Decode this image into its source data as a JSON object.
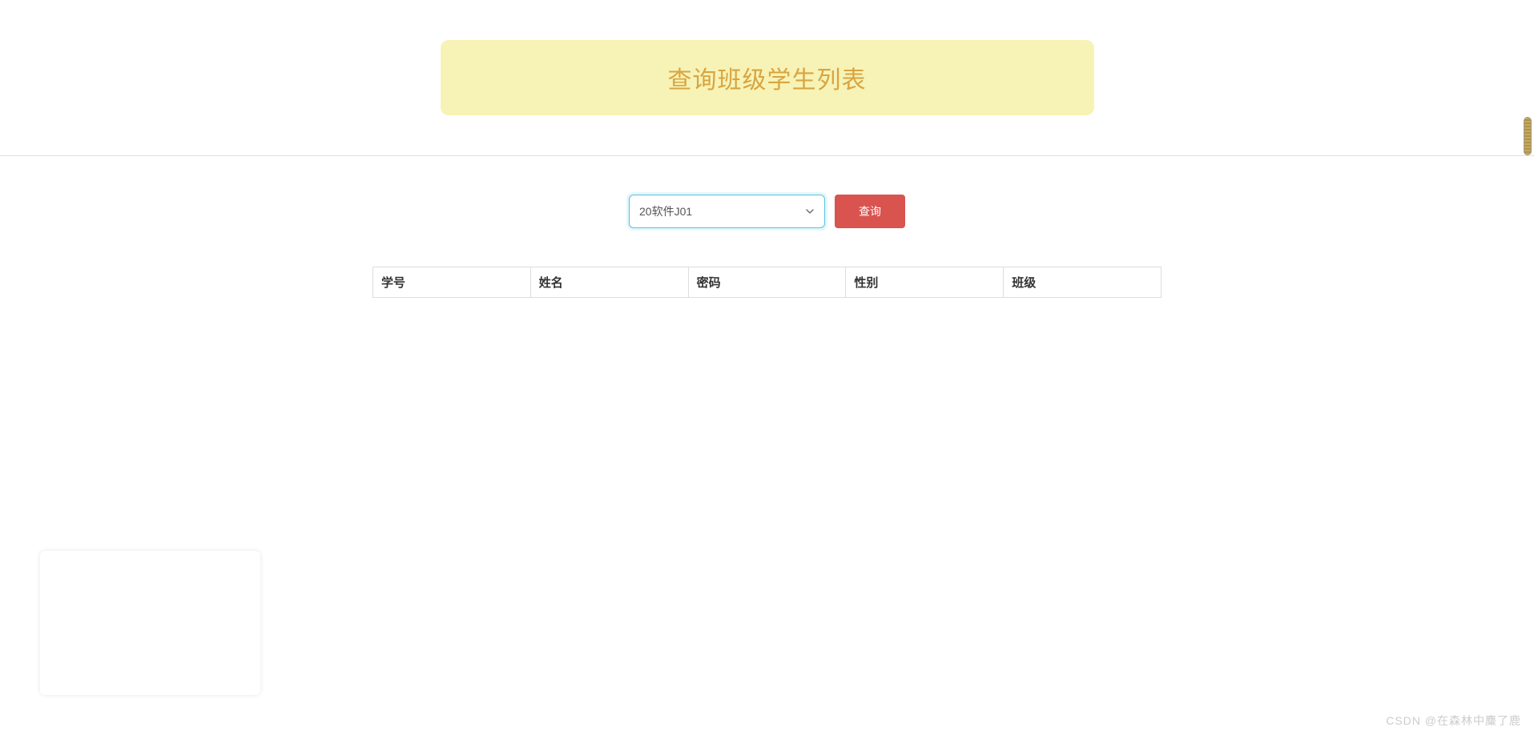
{
  "header": {
    "title": "查询班级学生列表"
  },
  "search": {
    "selected_class": "20软件J01",
    "query_button_label": "查询"
  },
  "table": {
    "headers": {
      "student_id": "学号",
      "name": "姓名",
      "password": "密码",
      "gender": "性别",
      "class": "班级"
    },
    "rows": []
  },
  "watermark": "CSDN @在森林中麋了鹿"
}
